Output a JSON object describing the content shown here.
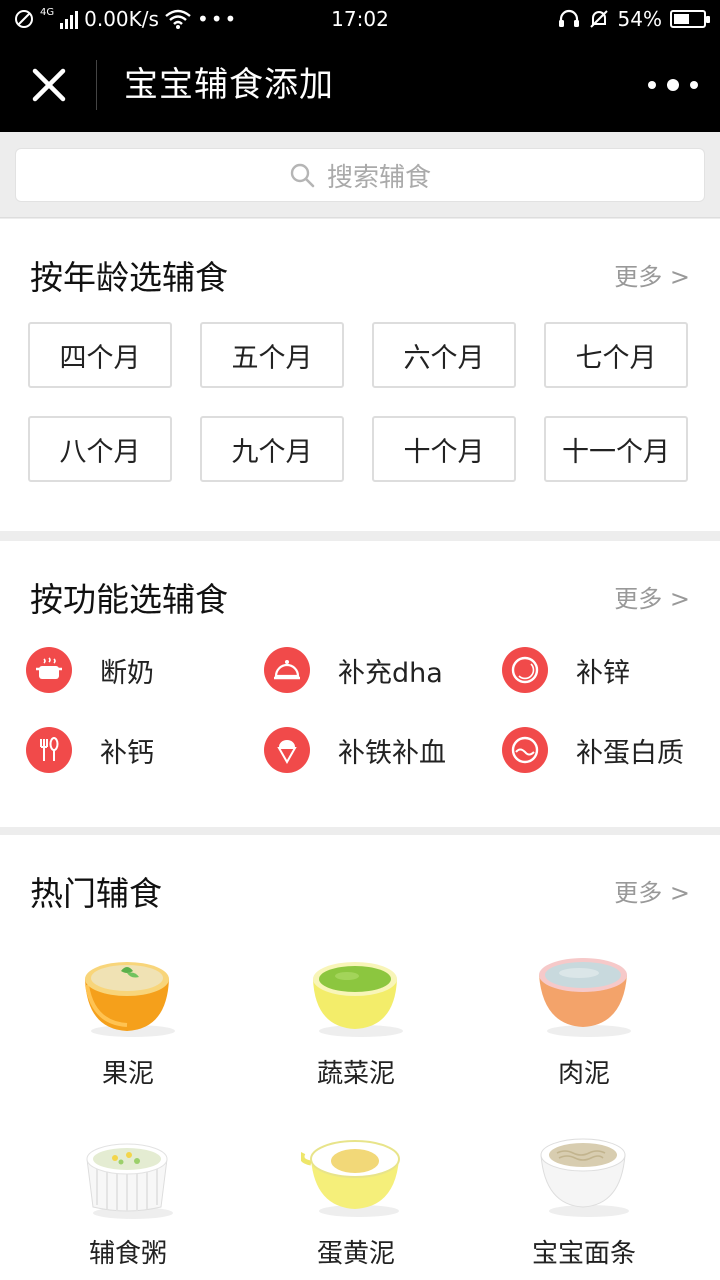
{
  "status": {
    "network_type": "4G",
    "speed": "0.00K/s",
    "time": "17:02",
    "battery": "54%",
    "battery_level": 0.54
  },
  "nav": {
    "title": "宝宝辅食添加"
  },
  "search": {
    "placeholder": "搜索辅食"
  },
  "age_section": {
    "title": "按年龄选辅食",
    "more": "更多 >",
    "items": [
      "四个月",
      "五个月",
      "六个月",
      "七个月",
      "八个月",
      "九个月",
      "十个月",
      "十一个月"
    ]
  },
  "function_section": {
    "title": "按功能选辅食",
    "more": "更多 >",
    "items": [
      {
        "label": "断奶",
        "icon": "pot-icon"
      },
      {
        "label": "补充dha",
        "icon": "dish-cover-icon"
      },
      {
        "label": "补锌",
        "icon": "ring-icon"
      },
      {
        "label": "补钙",
        "icon": "fork-spoon-icon"
      },
      {
        "label": "补铁补血",
        "icon": "ice-cream-icon"
      },
      {
        "label": "补蛋白质",
        "icon": "egg-icon"
      }
    ]
  },
  "hot_section": {
    "title": "热门辅食",
    "more": "更多 >",
    "items": [
      {
        "label": "果泥",
        "icon": "fruit-puree-bowl"
      },
      {
        "label": "蔬菜泥",
        "icon": "vegetable-puree-bowl"
      },
      {
        "label": "肉泥",
        "icon": "meat-puree-bowl"
      },
      {
        "label": "辅食粥",
        "icon": "porridge-bowl"
      },
      {
        "label": "蛋黄泥",
        "icon": "egg-yolk-bowl"
      },
      {
        "label": "宝宝面条",
        "icon": "noodle-bowl"
      }
    ]
  },
  "colors": {
    "accent_red": "#f14a4a",
    "bar_black": "#000000",
    "page_bg": "#ededed"
  }
}
